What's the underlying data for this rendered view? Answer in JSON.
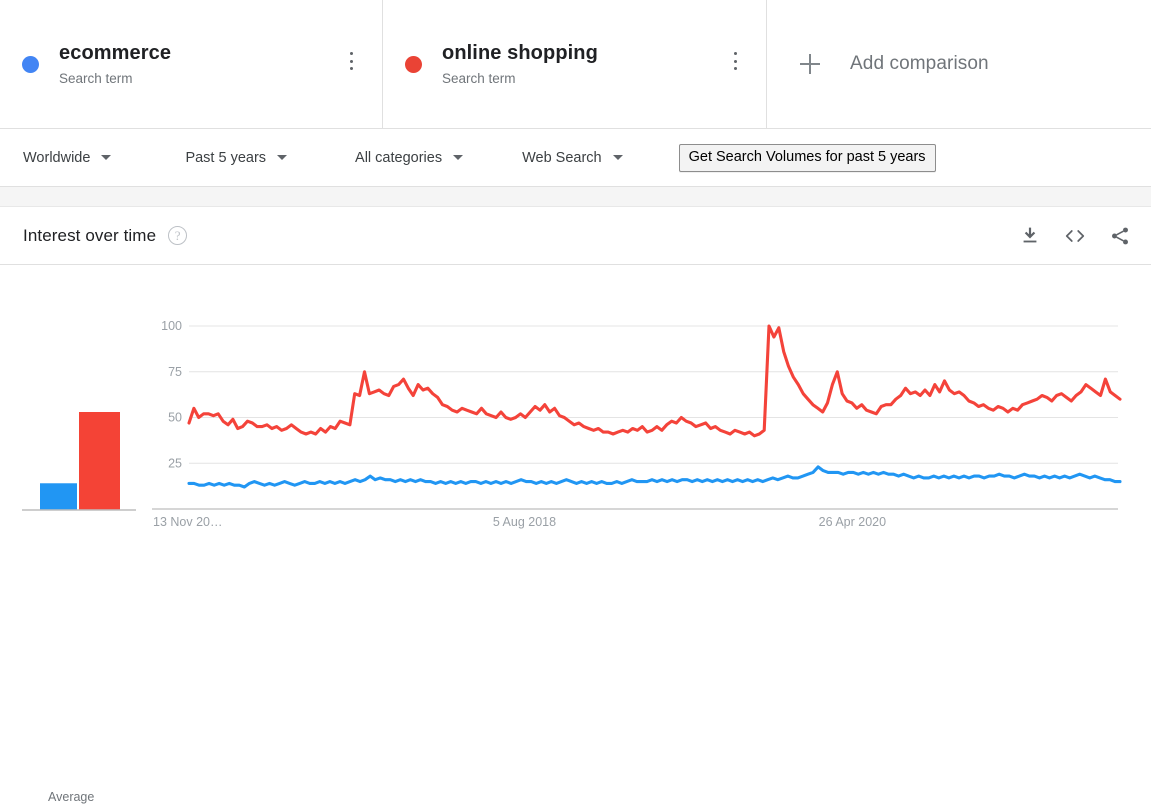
{
  "terms": [
    {
      "name": "ecommerce",
      "type": "Search term",
      "color": "#4285f4",
      "menu": "term-options"
    },
    {
      "name": "online shopping",
      "type": "Search term",
      "color": "#ea4335",
      "menu": "term-options"
    }
  ],
  "add_comparison": {
    "label": "Add comparison",
    "icon": "plus-icon"
  },
  "filters": [
    {
      "label": "Worldwide"
    },
    {
      "label": "Past 5 years"
    },
    {
      "label": "All categories"
    },
    {
      "label": "Web Search"
    }
  ],
  "volumes_button": {
    "label": "Get Search Volumes for past 5 years"
  },
  "panel": {
    "title": "Interest over time",
    "help": "?",
    "actions": [
      {
        "name": "download-icon"
      },
      {
        "name": "embed-icon"
      },
      {
        "name": "share-icon"
      }
    ]
  },
  "average_chart": {
    "label": "Average",
    "bars": [
      {
        "series": "ecommerce",
        "value": 15,
        "color": "#2196f3"
      },
      {
        "series": "online shopping",
        "value": 55,
        "color": "#f44336"
      }
    ]
  },
  "chart_data": {
    "type": "line",
    "title": "Interest over time",
    "xlabel": "",
    "ylabel": "",
    "ylim": [
      0,
      105
    ],
    "yticks": [
      25,
      50,
      75,
      100
    ],
    "ytick_labels": [
      "25",
      "50",
      "75",
      "100"
    ],
    "grid": true,
    "legend": "top-cards",
    "xtick_labels": [
      "13 Nov 20…",
      "5 Aug 2018",
      "26 Apr 2020"
    ],
    "xtick_positions": [
      0,
      0.365,
      0.715
    ],
    "colors": {
      "ecommerce": "#ea4335",
      "online shopping": "#ea4335"
    },
    "series": [
      {
        "name": "online shopping",
        "color": "#f4433a",
        "values": [
          47,
          55,
          50,
          52,
          52,
          51,
          52,
          48,
          46,
          49,
          44,
          45,
          48,
          47,
          45,
          45,
          46,
          44,
          45,
          43,
          44,
          46,
          44,
          42,
          41,
          42,
          41,
          44,
          42,
          45,
          44,
          48,
          47,
          46,
          63,
          62,
          75,
          63,
          64,
          65,
          63,
          62,
          67,
          68,
          71,
          66,
          62,
          68,
          65,
          66,
          63,
          61,
          57,
          56,
          54,
          53,
          55,
          54,
          53,
          52,
          55,
          52,
          51,
          50,
          53,
          50,
          49,
          50,
          52,
          50,
          53,
          56,
          54,
          57,
          53,
          55,
          51,
          50,
          48,
          46,
          47,
          45,
          44,
          43,
          44,
          42,
          42,
          41,
          42,
          43,
          42,
          44,
          43,
          45,
          42,
          43,
          45,
          43,
          46,
          48,
          47,
          50,
          48,
          47,
          45,
          46,
          47,
          44,
          45,
          43,
          42,
          41,
          43,
          42,
          41,
          42,
          40,
          41,
          43,
          100,
          94,
          99,
          86,
          78,
          72,
          68,
          63,
          60,
          57,
          55,
          53,
          58,
          68,
          75,
          63,
          59,
          58,
          55,
          57,
          54,
          53,
          52,
          56,
          57,
          57,
          60,
          62,
          66,
          63,
          64,
          62,
          65,
          62,
          68,
          64,
          70,
          65,
          63,
          64,
          62,
          59,
          58,
          56,
          57,
          55,
          54,
          56,
          55,
          53,
          55,
          54,
          57,
          58,
          59,
          60,
          62,
          61,
          59,
          62,
          63,
          61,
          59,
          62,
          64,
          68,
          66,
          64,
          62,
          71,
          64,
          62,
          60
        ]
      },
      {
        "name": "ecommerce",
        "color": "#2196f3",
        "values": [
          14,
          14,
          13,
          13,
          14,
          13,
          14,
          13,
          14,
          13,
          13,
          12,
          14,
          15,
          14,
          13,
          14,
          13,
          14,
          15,
          14,
          13,
          14,
          15,
          14,
          14,
          15,
          14,
          15,
          14,
          15,
          14,
          15,
          16,
          15,
          16,
          18,
          16,
          17,
          16,
          16,
          15,
          16,
          15,
          16,
          15,
          16,
          15,
          15,
          14,
          15,
          14,
          15,
          14,
          15,
          14,
          15,
          15,
          14,
          15,
          14,
          15,
          14,
          15,
          14,
          15,
          16,
          15,
          15,
          14,
          15,
          14,
          15,
          14,
          15,
          16,
          15,
          14,
          15,
          14,
          15,
          14,
          15,
          14,
          14,
          15,
          14,
          15,
          16,
          15,
          15,
          15,
          16,
          15,
          16,
          15,
          16,
          15,
          16,
          16,
          15,
          16,
          15,
          16,
          15,
          16,
          15,
          16,
          15,
          16,
          15,
          16,
          15,
          16,
          15,
          16,
          17,
          16,
          17,
          18,
          17,
          17,
          18,
          19,
          20,
          23,
          21,
          20,
          20,
          20,
          19,
          20,
          20,
          19,
          20,
          19,
          20,
          19,
          20,
          19,
          19,
          18,
          19,
          18,
          17,
          18,
          17,
          17,
          18,
          17,
          18,
          17,
          18,
          17,
          18,
          17,
          18,
          18,
          17,
          18,
          18,
          19,
          18,
          18,
          17,
          18,
          19,
          18,
          18,
          17,
          18,
          17,
          18,
          17,
          18,
          17,
          18,
          19,
          18,
          17,
          18,
          17,
          16,
          16,
          15,
          15
        ]
      }
    ]
  }
}
